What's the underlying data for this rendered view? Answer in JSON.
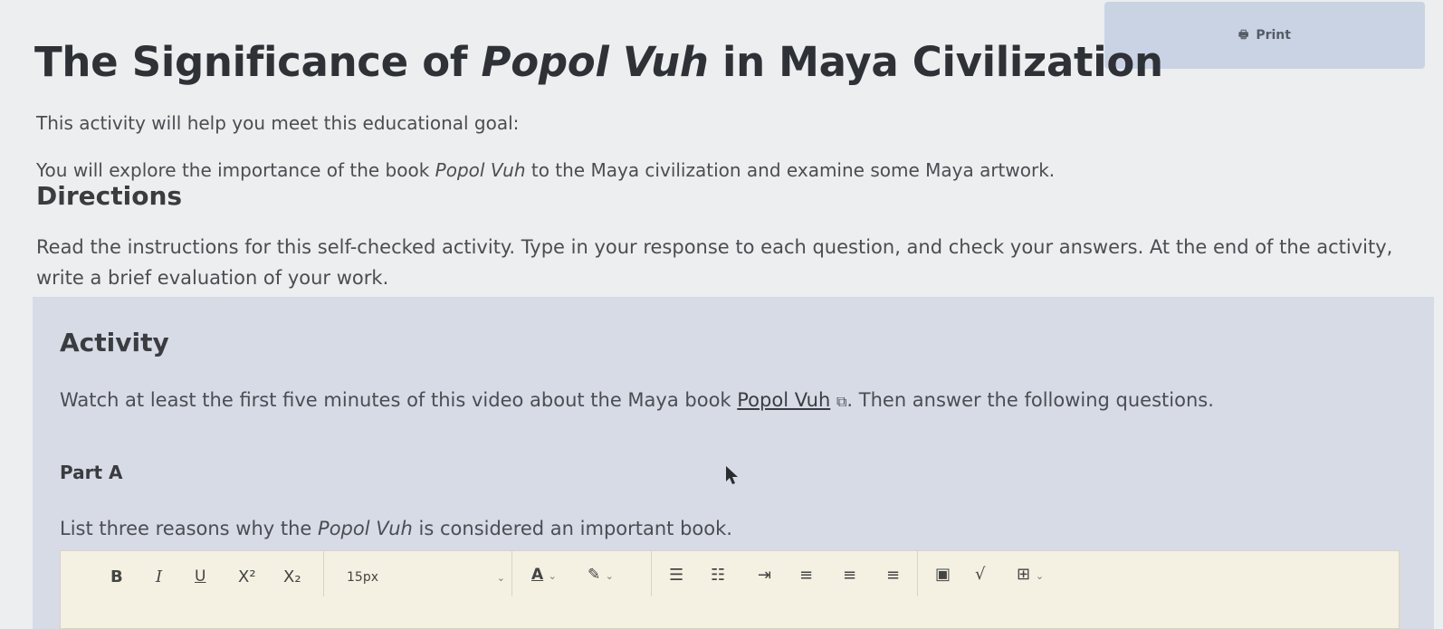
{
  "print": {
    "label": "Print",
    "icon": "printer-icon"
  },
  "page": {
    "title_prefix": "The Significance of ",
    "title_italic": "Popol Vuh",
    "title_suffix": " in Maya Civilization",
    "lead": "This activity will help you meet this educational goal:",
    "goal_prefix": "You will explore the importance of the book ",
    "goal_italic": "Popol Vuh",
    "goal_suffix": " to the Maya civilization and examine some Maya artwork."
  },
  "directions": {
    "heading": "Directions",
    "text": "Read the instructions for this self-checked activity. Type in your response to each question, and check your answers. At the end of the activity, write a brief evaluation of your work."
  },
  "activity": {
    "heading": "Activity",
    "text_prefix": "Watch at least the first five minutes of this video about the Maya book ",
    "link_text": "Popol Vuh",
    "text_suffix": ". Then answer the following questions."
  },
  "part_a": {
    "heading": "Part A",
    "prompt_prefix": "List three reasons why the ",
    "prompt_italic": "Popol Vuh",
    "prompt_suffix": " is considered an important book."
  },
  "toolbar": {
    "bold": "B",
    "italic": "I",
    "underline": "U",
    "superscript": "X²",
    "subscript": "X₂",
    "font_size": "15px"
  }
}
